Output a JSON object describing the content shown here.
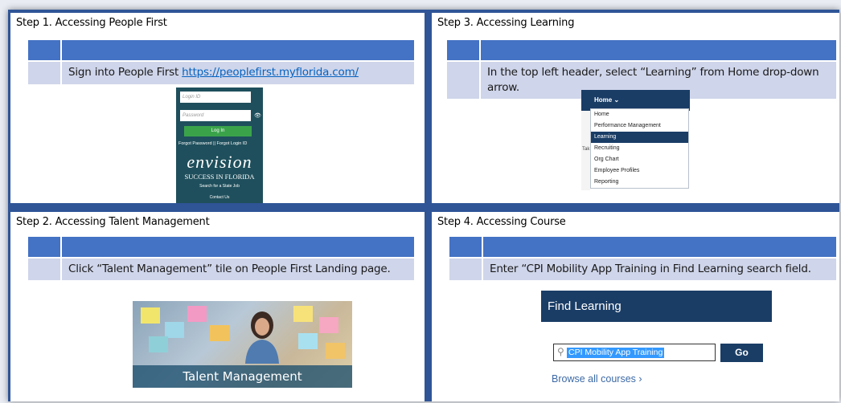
{
  "steps": {
    "s1": {
      "title": "Step 1. Accessing People First",
      "instruction_prefix": "Sign into People First ",
      "link": "https://peoplefirst.myflorida.com/",
      "login": {
        "login_id_placeholder": "Login ID",
        "password_placeholder": "Password",
        "button": "Log In",
        "forgot": "Forgot Password  ||  Forgot Login ID",
        "brand": "envision",
        "tagline": "SUCCESS IN FLORIDA",
        "search_link": "Search for a State Job",
        "contact": "Contact Us"
      }
    },
    "s2": {
      "title": "Step 2. Accessing Talent Management",
      "instruction": "Click “Talent Management” tile on People First Landing page.",
      "tile_label": "Talent Management"
    },
    "s3": {
      "title": "Step 3. Accessing Learning",
      "instruction": "In the top left header, select “Learning” from Home drop-down arrow.",
      "home_label": "Home  ⌄",
      "side_text": "Tak",
      "menu": [
        "Home",
        "Performance Management",
        "Learning",
        "Recruiting",
        "Org Chart",
        "Employee Profiles",
        "Reporting"
      ],
      "selected": "Learning"
    },
    "s4": {
      "title": "Step 4. Accessing Course",
      "instruction": "Enter “CPI Mobility App Training in Find Learning search field.",
      "find_learning": "Find Learning",
      "search_value": "CPI Mobility App Training",
      "go": "Go",
      "browse": "Browse all courses ›"
    }
  },
  "colors": {
    "frame": "#2f5597",
    "header_row": "#4472c4",
    "body_row": "#cfd5ea",
    "sf_navy": "#1a3d66"
  }
}
